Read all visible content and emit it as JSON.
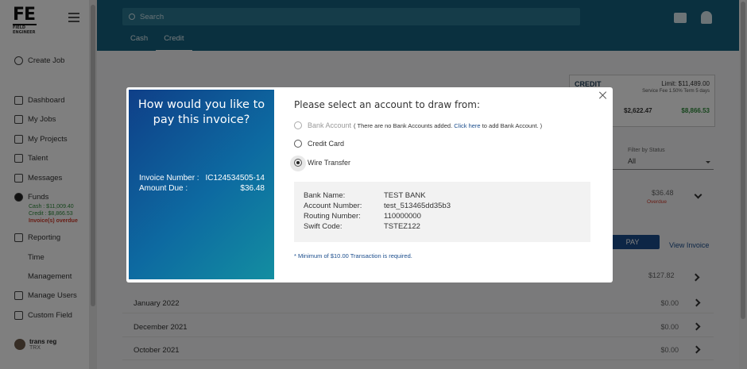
{
  "app": {
    "logo": "FE",
    "logo_sub": "FIELD ENGINEER",
    "search_placeholder": "Search",
    "tabs": [
      "Cash",
      "Credit"
    ]
  },
  "sidebar": {
    "create_job": "Create Job",
    "items": [
      "Dashboard",
      "My Jobs",
      "My Projects",
      "Talent",
      "Messages"
    ],
    "funds": {
      "label": "Funds",
      "cash": "Cash : $11,009.40",
      "credit": "Credit : $8,866.53",
      "warning": "Invoice(s) overdue"
    },
    "items2": [
      "Reporting",
      "Time",
      "Management",
      "Manage Users",
      "Custom Field"
    ],
    "user": {
      "name": "trans reg",
      "role": "TRX"
    }
  },
  "credit_summary": {
    "title": "CREDIT",
    "limit": "Limit: $11,489.00",
    "fee": "Service Fee 1.50%   Term 5 days",
    "amount1": "$2,622.47",
    "amount2": "$8,866.53"
  },
  "filter": {
    "label": "Filter by Status",
    "value": "All"
  },
  "invoice_rows": {
    "amount_1": "$36.48",
    "overdue": "Overdue",
    "pay": "PAY",
    "view_invoice": "View Invoice",
    "amount_2": "$127.82"
  },
  "months": [
    {
      "label": "January 2022",
      "value": "$0.00"
    },
    {
      "label": "December 2021",
      "value": "$0.00"
    },
    {
      "label": "October 2021",
      "value": "$0.00"
    }
  ],
  "modal": {
    "question": "How would you like to pay this invoice?",
    "invoice_label": "Invoice Number :",
    "invoice_number": "IC124534505-14",
    "amount_label": "Amount Due :",
    "amount_due": "$36.48",
    "prompt": "Please select an account to draw from:",
    "options": {
      "bank": "Bank Account",
      "bank_note_pre": "( There are no Bank Accounts added.",
      "bank_link": "Click here",
      "bank_note_post": "to add Bank Account. )",
      "credit": "Credit Card",
      "wire": "Wire Transfer"
    },
    "wire_details": [
      {
        "key": "Bank Name:",
        "value": "TEST BANK"
      },
      {
        "key": "Account Number:",
        "value": "test_513465dd35b3"
      },
      {
        "key": "Routing Number:",
        "value": "110000000"
      },
      {
        "key": "Swift Code:",
        "value": "TSTEZ122"
      }
    ],
    "min_note": "* Minimum of $10.00 Transaction is required."
  }
}
